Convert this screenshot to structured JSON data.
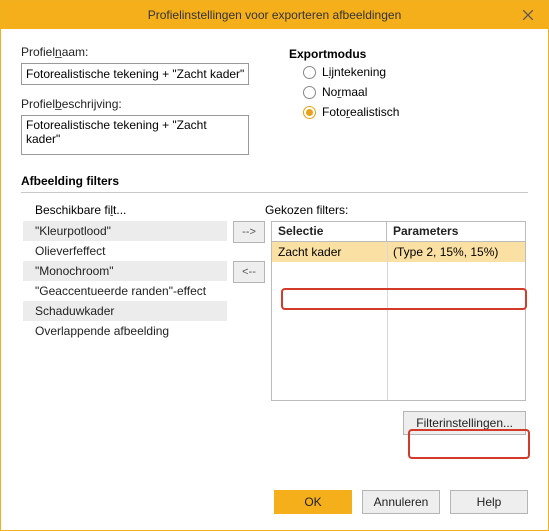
{
  "window": {
    "title": "Profielinstellingen voor exporteren afbeeldingen"
  },
  "labels": {
    "profile_name": "Profielnaam:",
    "profile_desc": "Profielbeschrijving:",
    "export_mode": "Exportmodus",
    "afbeelding_filters": "Afbeelding filters",
    "available_filters": "Beschikbare filt...",
    "chosen_filters": "Gekozen filters:",
    "col_selectie": "Selectie",
    "col_parameters": "Parameters"
  },
  "fields": {
    "profile_name_value": "Fotorealistische tekening + \"Zacht kader\"",
    "profile_desc_value": "Fotorealistische tekening + \"Zacht kader\""
  },
  "export_modes": {
    "line": "Lijntekening",
    "normal": "Normaal",
    "photo": "Fotorealistisch",
    "selected": "photo"
  },
  "available_filters": [
    "\"Kleurpotlood\"",
    "Olieverfeffect",
    "\"Monochroom\"",
    "\"Geaccentueerde randen\"-effect",
    "Schaduwkader",
    "Overlappende afbeelding"
  ],
  "chosen_filters": [
    {
      "selectie": "Zacht kader",
      "parameters": "(Type 2, 15%, 15%)"
    }
  ],
  "move_buttons": {
    "add": "-->",
    "remove": "<--"
  },
  "buttons": {
    "filter_settings": "Filterinstellingen...",
    "ok": "OK",
    "cancel": "Annuleren",
    "help": "Help"
  }
}
